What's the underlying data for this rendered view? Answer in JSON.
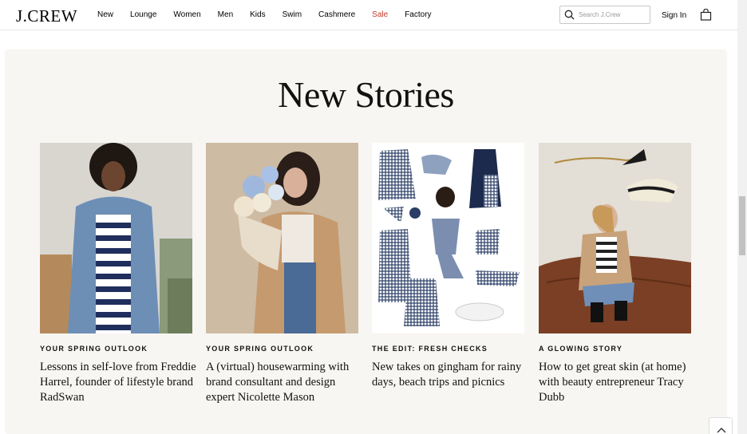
{
  "header": {
    "logo": "J.CREW",
    "nav": [
      {
        "label": "New"
      },
      {
        "label": "Lounge"
      },
      {
        "label": "Women"
      },
      {
        "label": "Men"
      },
      {
        "label": "Kids"
      },
      {
        "label": "Swim"
      },
      {
        "label": "Cashmere"
      },
      {
        "label": "Sale"
      },
      {
        "label": "Factory"
      }
    ],
    "search_placeholder": "Search J.Crew",
    "signin": "Sign In",
    "sale_color": "#c0392b"
  },
  "section": {
    "title": "New Stories",
    "background": "#f8f6f2",
    "cards": [
      {
        "eyebrow": "YOUR SPRING OUTLOOK",
        "headline": "Lessons in self-love from Freddie Harrel, founder of lifestyle brand RadSwan",
        "image": "woman in denim jacket and striped dress"
      },
      {
        "eyebrow": "YOUR SPRING OUTLOOK",
        "headline": "A (virtual) housewarming with brand consultant and design expert Nicolette Mason",
        "image": "woman in trench coat holding flowers"
      },
      {
        "eyebrow": "THE EDIT: FRESH CHECKS",
        "headline": "New takes on gingham for rainy days, beach trips and picnics",
        "image": "gingham clothing collage"
      },
      {
        "eyebrow": "A GLOWING STORY",
        "headline": "How to get great skin (at home) with beauty entrepreneur Tracy Dubb",
        "image": "woman sitting on leather sofa with bucket hat"
      }
    ]
  }
}
